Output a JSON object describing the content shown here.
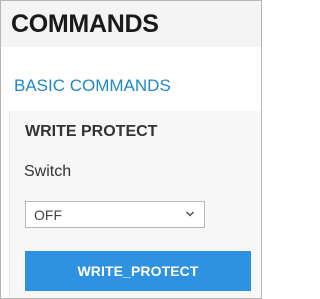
{
  "header": {
    "title": "COMMANDS"
  },
  "section": {
    "title": "BASIC COMMANDS"
  },
  "panel": {
    "title": "WRITE PROTECT",
    "switch_label": "Switch",
    "switch_select": {
      "value": "OFF",
      "icon": "chevron-down-icon"
    },
    "action_button_label": "WRITE_PROTECT"
  },
  "colors": {
    "section_title": "#1e88c8",
    "button_background": "#2e92e3",
    "button_text": "#ffffff",
    "header_background": "#f4f4f4"
  }
}
